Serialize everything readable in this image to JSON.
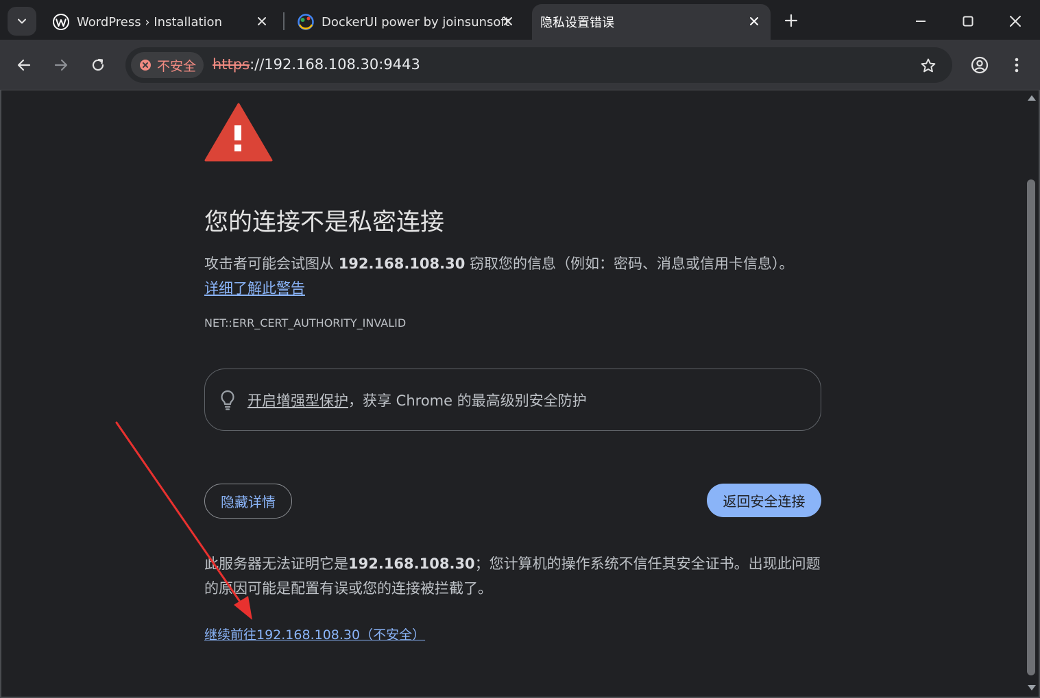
{
  "browser": {
    "tabs": [
      {
        "title": "WordPress › Installation",
        "favicon": "wordpress-icon"
      },
      {
        "title": "DockerUI power by joinsunsoft",
        "favicon": "dockerui-icon"
      },
      {
        "title": "隐私设置错误",
        "favicon": ""
      }
    ],
    "security_chip": "不安全",
    "url_scheme": "https",
    "url_rest": "://192.168.108.30:9443",
    "colors": {
      "accent": "#8ab4f8",
      "danger": "#f28b82",
      "warning": "#db4437"
    }
  },
  "page": {
    "heading": "您的连接不是私密连接",
    "attack_pre": "攻击者可能会试图从 ",
    "attack_host": "192.168.108.30",
    "attack_post": " 窃取您的信息（例如：密码、消息或信用卡信息）。",
    "learn_more": "详细了解此警告",
    "error_code": "NET::ERR_CERT_AUTHORITY_INVALID",
    "promo_link": "开启增强型保护",
    "promo_rest": "，获享 Chrome 的最高级别安全防护",
    "hide_details": "隐藏详情",
    "back_to_safety": "返回安全连接",
    "detail_pre": "此服务器无法证明它是",
    "detail_host": "192.168.108.30",
    "detail_post": "；您计算机的操作系统不信任其安全证书。出现此问题的原因可能是配置有误或您的连接被拦截了。",
    "proceed_link": "继续前往192.168.108.30（不安全）"
  }
}
